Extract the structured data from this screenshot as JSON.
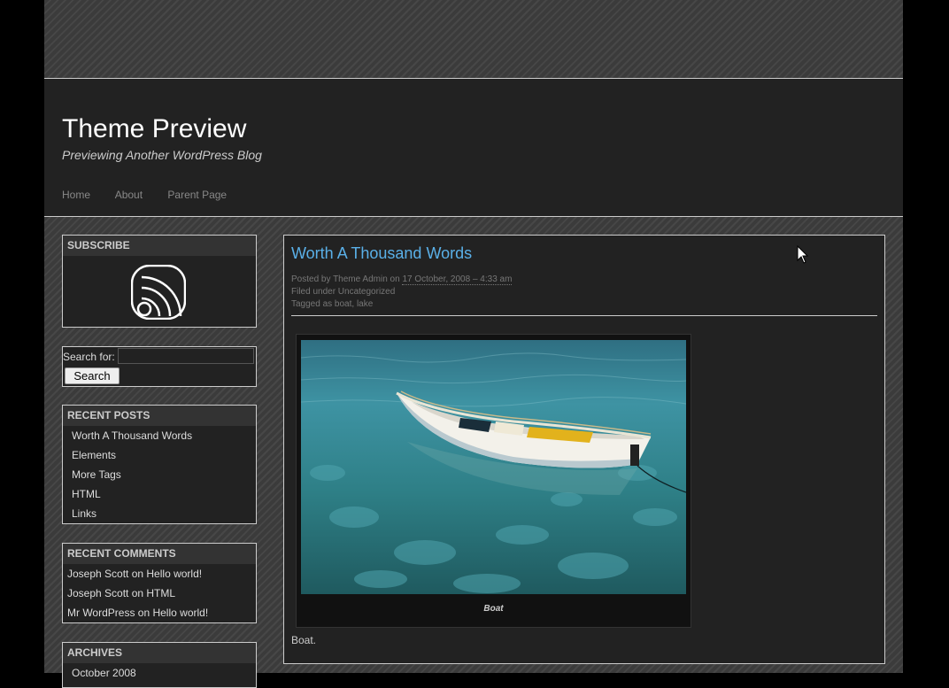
{
  "site": {
    "title": "Theme Preview",
    "description": "Previewing Another WordPress Blog"
  },
  "nav": [
    "Home",
    "About",
    "Parent Page"
  ],
  "sidebar": {
    "subscribe": {
      "title": "SUBSCRIBE",
      "icon": "rss-feed-icon"
    },
    "search": {
      "label": "Search for:",
      "value": "",
      "button": "Search"
    },
    "recent_posts": {
      "title": "RECENT POSTS",
      "items": [
        "Worth A Thousand Words",
        "Elements",
        "More Tags",
        "HTML",
        "Links"
      ]
    },
    "recent_comments": {
      "title": "RECENT COMMENTS",
      "items": [
        "Joseph Scott on Hello world!",
        "Joseph Scott on HTML",
        "Mr WordPress on Hello world!"
      ]
    },
    "archives": {
      "title": "ARCHIVES",
      "items": [
        "October 2008"
      ]
    }
  },
  "post": {
    "title": "Worth A Thousand Words",
    "posted_by": "Posted by Theme Admin on",
    "date": "17 October, 2008 – 4:33 am",
    "filed": "Filed under Uncategorized",
    "tagged": "Tagged as boat, lake",
    "image_caption": "Boat",
    "body": "Boat."
  },
  "colors": {
    "link": "#5ab0e8",
    "panel": "#222222",
    "border": "#cccccc"
  }
}
